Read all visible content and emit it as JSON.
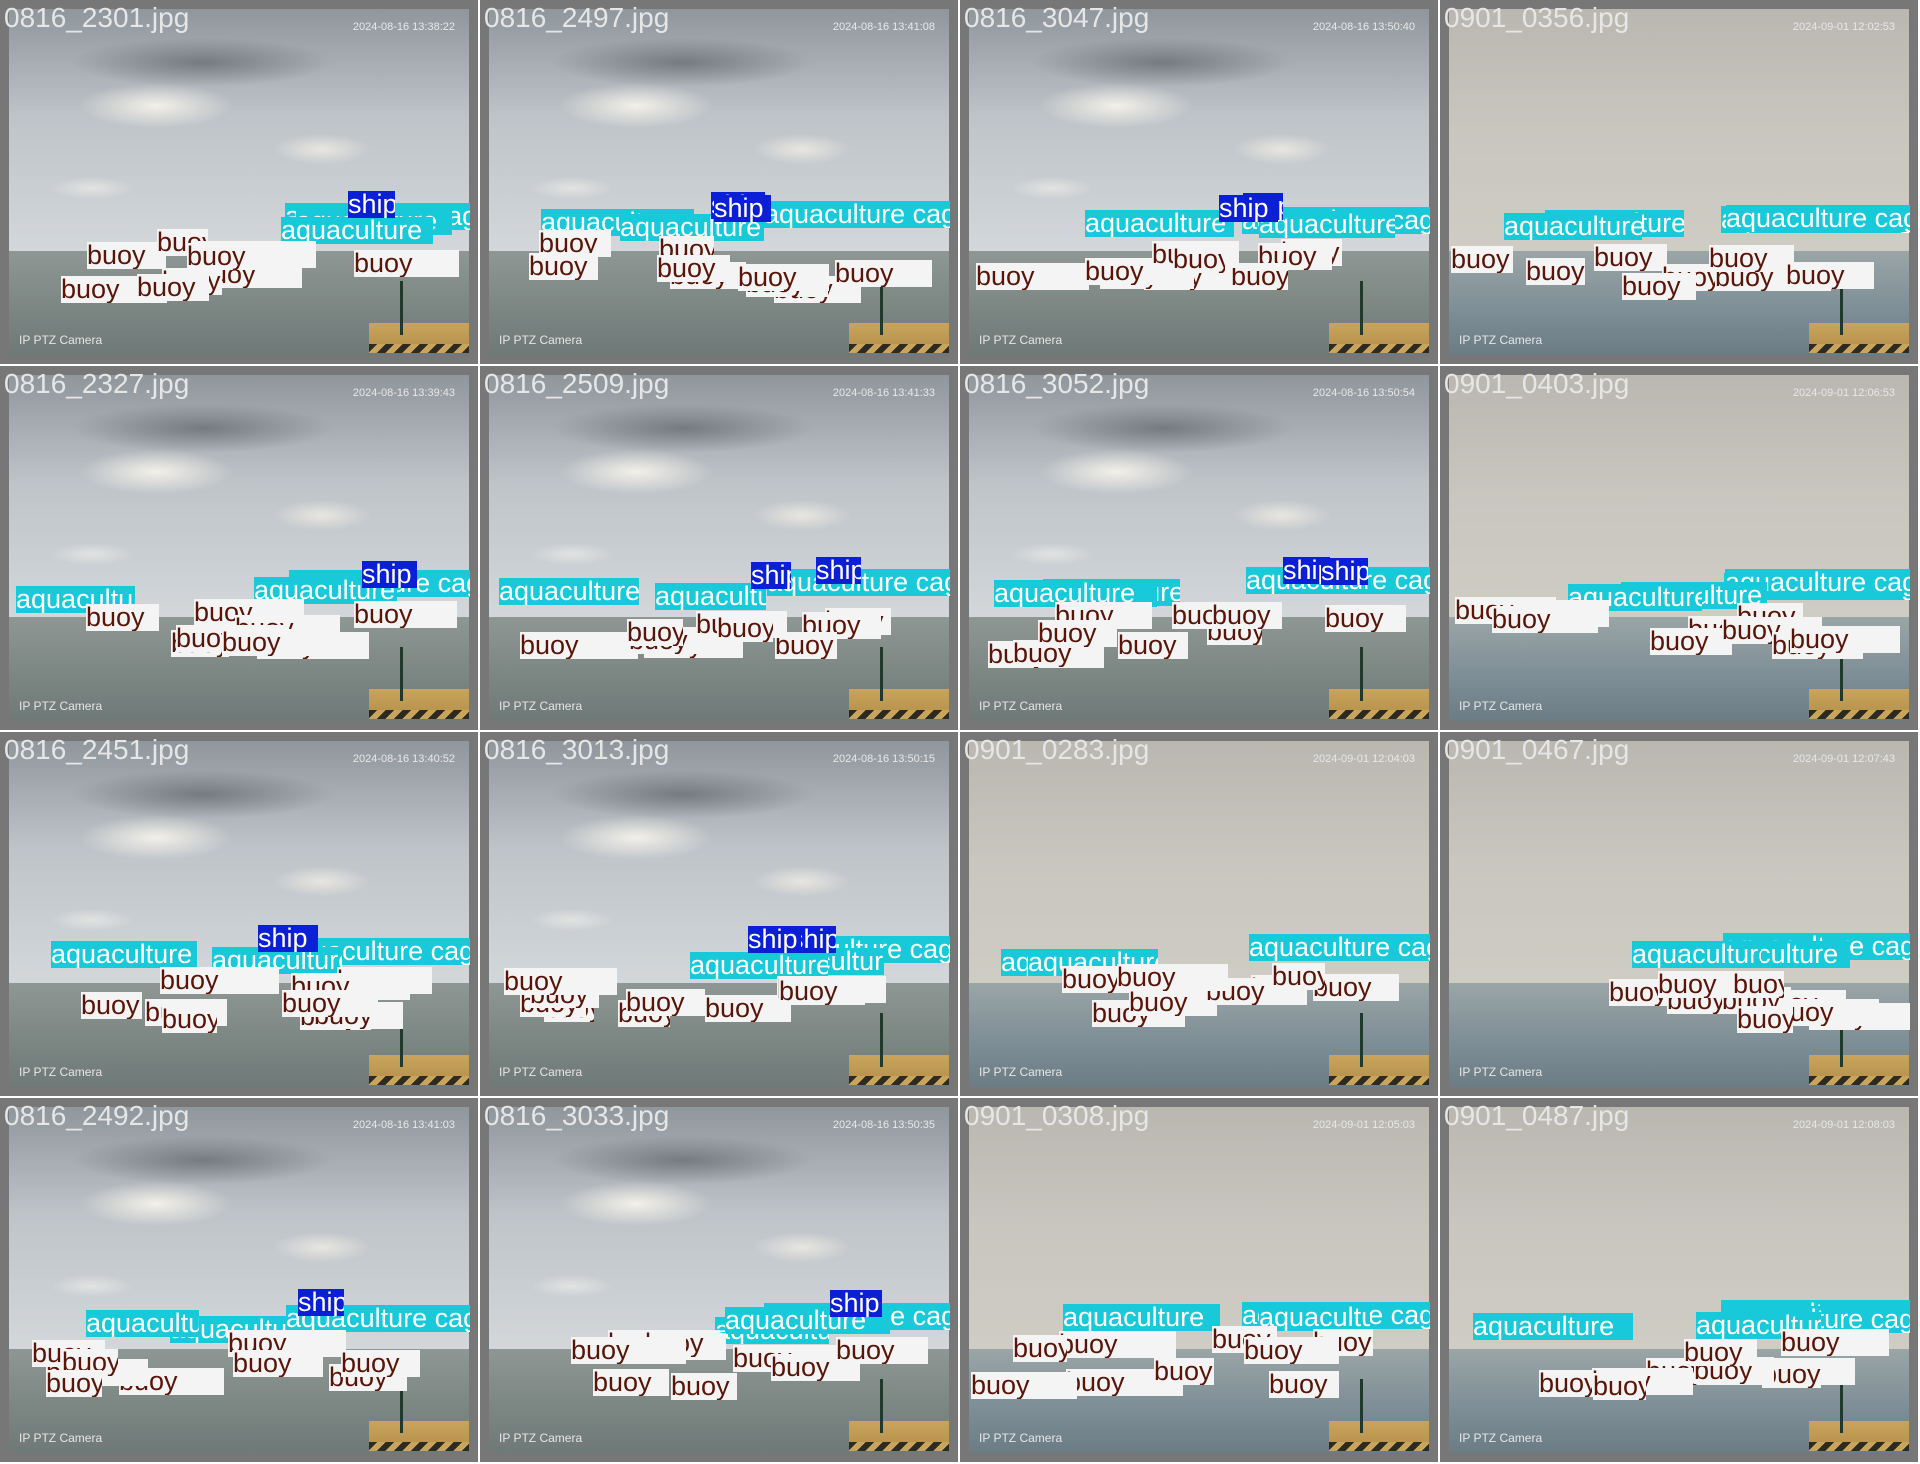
{
  "grid": {
    "camera_label": "IP PTZ Camera",
    "tiles": [
      {
        "file": "0816_2301.jpg",
        "timestamp": "2024-08-16 13:38:22",
        "scene": "cloudy",
        "detections": [
          "aquaculture cage",
          "aquaculture",
          "aquaculture",
          "buoy",
          "buoy",
          "buoy",
          "buoy",
          "buoy",
          "buoy",
          "buoy",
          "buoy",
          "buoy",
          "ship"
        ]
      },
      {
        "file": "0816_2497.jpg",
        "timestamp": "2024-08-16 13:41:08",
        "scene": "cloudy",
        "detections": [
          "aquaculture cage",
          "aquaculture",
          "aquaculture",
          "buoy",
          "buoy",
          "buoy",
          "buoy",
          "buoy",
          "buoy",
          "buoy",
          "buoy",
          "buoy",
          "ship",
          "ship"
        ]
      },
      {
        "file": "0816_3047.jpg",
        "timestamp": "2024-08-16 13:50:40",
        "scene": "cloudy",
        "detections": [
          "aquaculture cage",
          "aquaculture",
          "aquaculture",
          "buoy",
          "buoy",
          "buoy",
          "buoy",
          "buoy",
          "buoy",
          "buoy",
          "buoy",
          "buoy",
          "ship",
          "ship"
        ]
      },
      {
        "file": "0901_0356.jpg",
        "timestamp": "2024-09-01 12:02:53",
        "scene": "hazy",
        "detections": [
          "aquaculture cage",
          "aquaculture cage",
          "aquaculture",
          "aquaculture",
          "buoy",
          "buoy",
          "buoy",
          "buoy",
          "buoy",
          "buoy",
          "buoy",
          "buoy"
        ]
      },
      {
        "file": "0816_2327.jpg",
        "timestamp": "2024-08-16 13:39:43",
        "scene": "cloudy",
        "detections": [
          "aquaculture cage",
          "aquaculture",
          "aquaculture",
          "buoy",
          "buoy",
          "buoy",
          "buoy",
          "buoy",
          "buoy",
          "buoy",
          "buoy",
          "ship"
        ]
      },
      {
        "file": "0816_2509.jpg",
        "timestamp": "2024-08-16 13:41:33",
        "scene": "cloudy",
        "detections": [
          "aquaculture cage",
          "aquaculture",
          "aquaculture",
          "buoy",
          "buoy",
          "buoy",
          "buoy",
          "buoy",
          "buoy",
          "buoy",
          "buoy",
          "buoy",
          "ship",
          "ship"
        ]
      },
      {
        "file": "0816_3052.jpg",
        "timestamp": "2024-08-16 13:50:54",
        "scene": "cloudy",
        "detections": [
          "aquaculture cage",
          "aquaculture",
          "aquaculture",
          "buoy",
          "buoy",
          "buoy",
          "buoy",
          "buoy",
          "buoy",
          "buoy",
          "buoy",
          "buoy",
          "ship",
          "ship"
        ]
      },
      {
        "file": "0901_0403.jpg",
        "timestamp": "2024-09-01 12:06:53",
        "scene": "hazy",
        "detections": [
          "aquaculture cage",
          "aquaculture cage",
          "aquaculture",
          "aquaculture",
          "buoy",
          "buoy",
          "buoy",
          "buoy",
          "buoy",
          "buoy",
          "buoy",
          "buoy",
          "buoy"
        ]
      },
      {
        "file": "0816_2451.jpg",
        "timestamp": "2024-08-16 13:40:52",
        "scene": "cloudy",
        "detections": [
          "aquaculture cage",
          "aquaculture",
          "aquaculture",
          "buoy",
          "buoy",
          "buoy",
          "buoy",
          "buoy",
          "buoy",
          "buoy",
          "buoy",
          "buoy",
          "ship"
        ]
      },
      {
        "file": "0816_3013.jpg",
        "timestamp": "2024-08-16 13:50:15",
        "scene": "cloudy",
        "detections": [
          "aquaculture cage",
          "aquaculture",
          "aquaculture",
          "buoy",
          "buoy",
          "buoy",
          "buoy",
          "buoy",
          "buoy",
          "buoy",
          "buoy",
          "buoy",
          "ship",
          "ship"
        ]
      },
      {
        "file": "0901_0283.jpg",
        "timestamp": "2024-09-01 12:04:03",
        "scene": "hazy",
        "detections": [
          "aquaculture cage",
          "aquaculture",
          "aquaculture",
          "buoy",
          "buoy",
          "buoy",
          "buoy",
          "buoy",
          "buoy",
          "buoy",
          "buoy",
          "buoy"
        ]
      },
      {
        "file": "0901_0467.jpg",
        "timestamp": "2024-09-01 12:07:43",
        "scene": "hazy",
        "detections": [
          "aquaculture cage",
          "aquaculture cage",
          "aquaculture",
          "aquaculture",
          "buoy",
          "buoy",
          "buoy",
          "buoy",
          "buoy",
          "buoy",
          "buoy",
          "buoy",
          "buoy"
        ]
      },
      {
        "file": "0816_2492.jpg",
        "timestamp": "2024-08-16 13:41:03",
        "scene": "cloudy",
        "detections": [
          "aquaculture cage",
          "aquaculture",
          "aquaculture",
          "buoy",
          "buoy",
          "buoy",
          "buoy",
          "buoy",
          "buoy",
          "buoy",
          "buoy",
          "buoy",
          "ship"
        ]
      },
      {
        "file": "0816_3033.jpg",
        "timestamp": "2024-08-16 13:50:35",
        "scene": "cloudy",
        "detections": [
          "aquaculture cage",
          "aquaculture",
          "aquaculture",
          "buoy",
          "buoy",
          "buoy",
          "buoy",
          "buoy",
          "buoy",
          "buoy",
          "buoy",
          "buoy",
          "ship"
        ]
      },
      {
        "file": "0901_0308.jpg",
        "timestamp": "2024-09-01 12:05:03",
        "scene": "hazy",
        "detections": [
          "aquaculture cage",
          "aquaculture",
          "aquaculture",
          "buoy",
          "buoy",
          "buoy",
          "buoy",
          "buoy",
          "buoy",
          "buoy",
          "buoy",
          "buoy"
        ]
      },
      {
        "file": "0901_0487.jpg",
        "timestamp": "2024-09-01 12:08:03",
        "scene": "hazy",
        "detections": [
          "aquaculture cage",
          "aquaculture cage",
          "aquaculture",
          "aquaculture",
          "buoy",
          "buoy",
          "buoy",
          "buoy",
          "buoy",
          "buoy",
          "buoy",
          "buoy",
          "buoy"
        ]
      }
    ]
  },
  "colors": {
    "aquaculture": "#18c9d9",
    "buoy_background": "#f4f4f4",
    "buoy_text": "#5a1408",
    "ship": "#0a1fd6",
    "tile_border": "#777777"
  }
}
